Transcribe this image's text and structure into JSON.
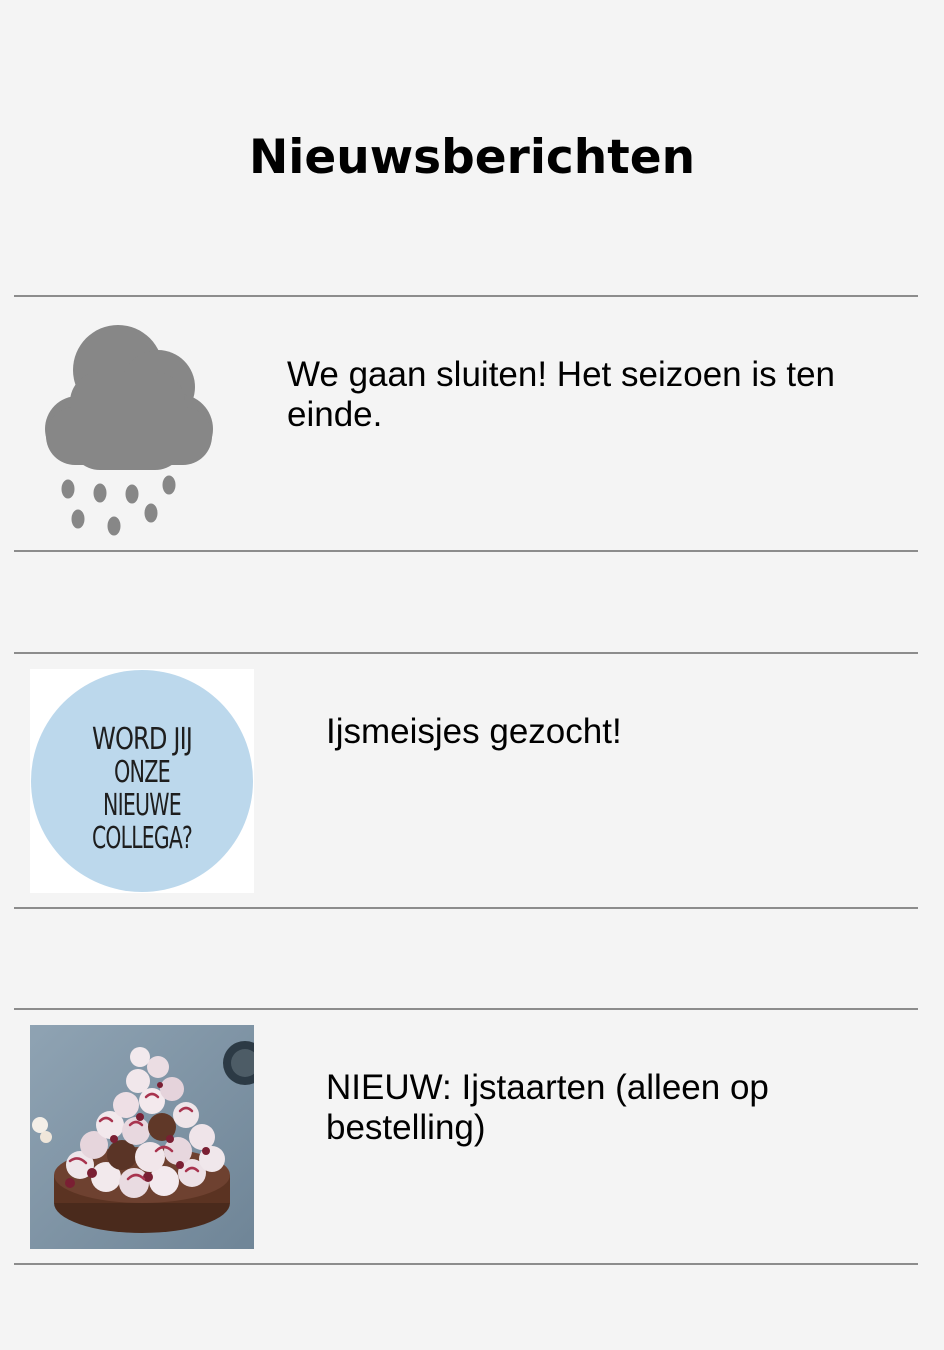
{
  "page": {
    "title": "Nieuwsberichten"
  },
  "news": [
    {
      "text": "We gaan sluiten! Het seizoen is ten einde.",
      "image": "rain-cloud-icon"
    },
    {
      "text": "Ijsmeisjes gezocht!",
      "image": "vacancy-badge",
      "image_text": [
        "WORD JIJ",
        "ONZE",
        "NIEUWE",
        "COLLEGA?"
      ]
    },
    {
      "text": "NIEUW: Ijstaarten (alleen op bestelling)",
      "image": "ice-cake-photo"
    }
  ],
  "colors": {
    "background": "#f4f4f4",
    "divider": "#8c8c8c",
    "cloud": "#878787",
    "badge_circle": "#bcd8ec"
  }
}
